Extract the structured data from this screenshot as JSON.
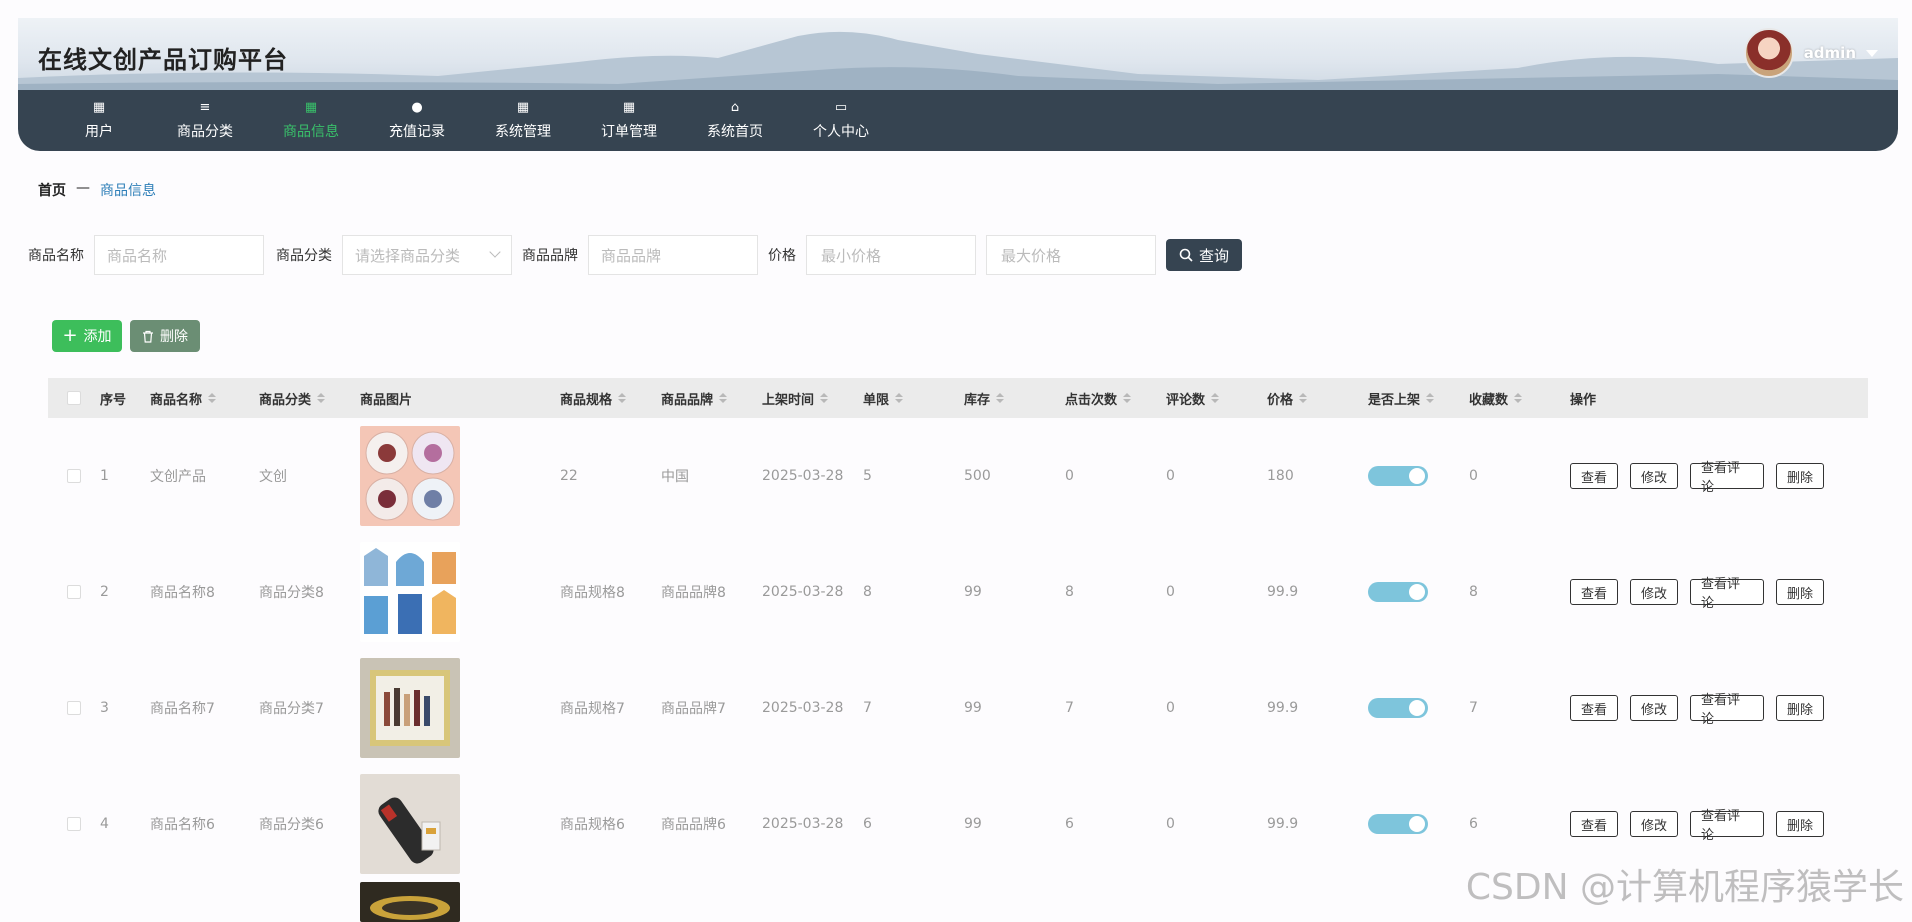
{
  "header": {
    "title": "在线文创产品订购平台",
    "username": "admin"
  },
  "nav": [
    {
      "label": "用户",
      "icon": "grid-icon",
      "glyph": "▦"
    },
    {
      "label": "商品分类",
      "icon": "sliders-icon",
      "glyph": "≡"
    },
    {
      "label": "商品信息",
      "icon": "grid-icon",
      "glyph": "▦",
      "active": true
    },
    {
      "label": "充值记录",
      "icon": "bulb-icon",
      "glyph": "●"
    },
    {
      "label": "系统管理",
      "icon": "grid-icon",
      "glyph": "▦"
    },
    {
      "label": "订单管理",
      "icon": "grid-icon",
      "glyph": "▦"
    },
    {
      "label": "系统首页",
      "icon": "home-icon",
      "glyph": "⌂"
    },
    {
      "label": "个人中心",
      "icon": "wallet-icon",
      "glyph": "▭"
    }
  ],
  "breadcrumb": {
    "home": "首页",
    "sep": "—",
    "current": "商品信息"
  },
  "search": {
    "name_label": "商品名称",
    "name_placeholder": "商品名称",
    "category_label": "商品分类",
    "category_placeholder": "请选择商品分类",
    "brand_label": "商品品牌",
    "brand_placeholder": "商品品牌",
    "price_label": "价格",
    "min_placeholder": "最小价格",
    "max_placeholder": "最大价格",
    "query_button": "查询"
  },
  "actions": {
    "add": "添加",
    "delete": "删除"
  },
  "table": {
    "headers": [
      "序号",
      "商品名称",
      "商品分类",
      "商品图片",
      "商品规格",
      "商品品牌",
      "上架时间",
      "单限",
      "库存",
      "点击次数",
      "评论数",
      "价格",
      "是否上架",
      "收藏数",
      "操作"
    ],
    "rows": [
      {
        "no": "1",
        "name": "文创产品",
        "category": "文创",
        "spec": "22",
        "brand": "中国",
        "date": "2025-03-28",
        "limit": "5",
        "stock": "500",
        "clicks": "0",
        "comments": "0",
        "price": "180",
        "on_sale": true,
        "favorites": "0",
        "image": "badges"
      },
      {
        "no": "2",
        "name": "商品名称8",
        "category": "商品分类8",
        "spec": "商品规格8",
        "brand": "商品品牌8",
        "date": "2025-03-28",
        "limit": "8",
        "stock": "99",
        "clicks": "8",
        "comments": "0",
        "price": "99.9",
        "on_sale": true,
        "favorites": "8",
        "image": "stickers"
      },
      {
        "no": "3",
        "name": "商品名称7",
        "category": "商品分类7",
        "spec": "商品规格7",
        "brand": "商品品牌7",
        "date": "2025-03-28",
        "limit": "7",
        "stock": "99",
        "clicks": "7",
        "comments": "0",
        "price": "99.9",
        "on_sale": true,
        "favorites": "7",
        "image": "gift-box"
      },
      {
        "no": "4",
        "name": "商品名称6",
        "category": "商品分类6",
        "spec": "商品规格6",
        "brand": "商品品牌6",
        "date": "2025-03-28",
        "limit": "6",
        "stock": "99",
        "clicks": "6",
        "comments": "0",
        "price": "99.9",
        "on_sale": true,
        "favorites": "6",
        "image": "usb-drive"
      }
    ],
    "row_actions": [
      "查看",
      "修改",
      "查看评论",
      "删除"
    ]
  },
  "watermark": "CSDN @计算机程序猿学长",
  "colors": {
    "nav_bg": "#364451",
    "active": "#39c06a",
    "add": "#3dbe5b",
    "delete": "#6b8e74",
    "toggle": "#7ec5dc"
  }
}
